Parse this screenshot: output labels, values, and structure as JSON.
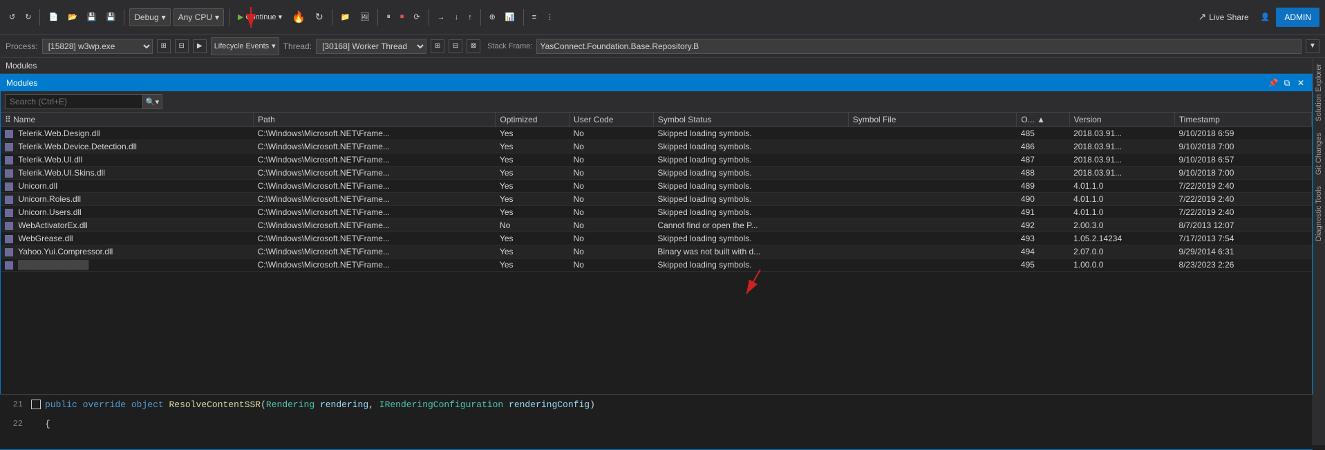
{
  "toolbar": {
    "debug_label": "Debug",
    "any_cpu_label": "Any CPU",
    "continue_label": "Continue",
    "live_share_label": "Live Share",
    "admin_label": "ADMIN"
  },
  "debug_bar": {
    "process_label": "Process:",
    "process_value": "[15828] w3wp.exe",
    "lifecycle_label": "Lifecycle Events",
    "thread_label": "Thread:",
    "thread_value": "[30168] Worker Thread",
    "stack_frame_value": "YasConnect.Foundation.Base.Repository.B"
  },
  "modules_panel": {
    "header": "Modules",
    "window_title": "Modules",
    "search_placeholder": "Search (Ctrl+E)"
  },
  "table": {
    "columns": [
      "Name",
      "Path",
      "Optimized",
      "User Code",
      "Symbol Status",
      "Symbol File",
      "O...",
      "Version",
      "Timestamp"
    ],
    "rows": [
      {
        "name": "Telerik.Web.Design.dll",
        "path": "C:\\Windows\\Microsoft.NET\\Frame...",
        "optimized": "Yes",
        "user_code": "No",
        "symbol_status": "Skipped loading symbols.",
        "symbol_file": "",
        "o": "485",
        "version": "2018.03.91...",
        "timestamp": "9/10/2018 6:59"
      },
      {
        "name": "Telerik.Web.Device.Detection.dll",
        "path": "C:\\Windows\\Microsoft.NET\\Frame...",
        "optimized": "Yes",
        "user_code": "No",
        "symbol_status": "Skipped loading symbols.",
        "symbol_file": "",
        "o": "486",
        "version": "2018.03.91...",
        "timestamp": "9/10/2018 7:00"
      },
      {
        "name": "Telerik.Web.UI.dll",
        "path": "C:\\Windows\\Microsoft.NET\\Frame...",
        "optimized": "Yes",
        "user_code": "No",
        "symbol_status": "Skipped loading symbols.",
        "symbol_file": "",
        "o": "487",
        "version": "2018.03.91...",
        "timestamp": "9/10/2018 6:57"
      },
      {
        "name": "Telerik.Web.UI.Skins.dll",
        "path": "C:\\Windows\\Microsoft.NET\\Frame...",
        "optimized": "Yes",
        "user_code": "No",
        "symbol_status": "Skipped loading symbols.",
        "symbol_file": "",
        "o": "488",
        "version": "2018.03.91...",
        "timestamp": "9/10/2018 7:00"
      },
      {
        "name": "Unicorn.dll",
        "path": "C:\\Windows\\Microsoft.NET\\Frame...",
        "optimized": "Yes",
        "user_code": "No",
        "symbol_status": "Skipped loading symbols.",
        "symbol_file": "",
        "o": "489",
        "version": "4.01.1.0",
        "timestamp": "7/22/2019 2:40"
      },
      {
        "name": "Unicorn.Roles.dll",
        "path": "C:\\Windows\\Microsoft.NET\\Frame...",
        "optimized": "Yes",
        "user_code": "No",
        "symbol_status": "Skipped loading symbols.",
        "symbol_file": "",
        "o": "490",
        "version": "4.01.1.0",
        "timestamp": "7/22/2019 2:40"
      },
      {
        "name": "Unicorn.Users.dll",
        "path": "C:\\Windows\\Microsoft.NET\\Frame...",
        "optimized": "Yes",
        "user_code": "No",
        "symbol_status": "Skipped loading symbols.",
        "symbol_file": "",
        "o": "491",
        "version": "4.01.1.0",
        "timestamp": "7/22/2019 2:40"
      },
      {
        "name": "WebActivatorEx.dll",
        "path": "C:\\Windows\\Microsoft.NET\\Frame...",
        "optimized": "No",
        "user_code": "No",
        "symbol_status": "Cannot find or open the P...",
        "symbol_file": "",
        "o": "492",
        "version": "2.00.3.0",
        "timestamp": "8/7/2013 12:07"
      },
      {
        "name": "WebGrease.dll",
        "path": "C:\\Windows\\Microsoft.NET\\Frame...",
        "optimized": "Yes",
        "user_code": "No",
        "symbol_status": "Skipped loading symbols.",
        "symbol_file": "",
        "o": "493",
        "version": "1.05.2.14234",
        "timestamp": "7/17/2013 7:54"
      },
      {
        "name": "Yahoo.Yui.Compressor.dll",
        "path": "C:\\Windows\\Microsoft.NET\\Frame...",
        "optimized": "Yes",
        "user_code": "No",
        "symbol_status": "Binary was not built with d...",
        "symbol_file": "",
        "o": "494",
        "version": "2.07.0.0",
        "timestamp": "9/29/2014 6:31"
      },
      {
        "name": "████████████",
        "path": "C:\\Windows\\Microsoft.NET\\Frame...",
        "optimized": "Yes",
        "user_code": "No",
        "symbol_status": "Skipped loading symbols.",
        "symbol_file": "",
        "o": "495",
        "version": "1.00.0.0",
        "timestamp": "8/23/2023 2:26"
      }
    ]
  },
  "code_panel": {
    "line21": "21",
    "line22": "22",
    "code21": "public override object ResolveContentSSR(Rendering rendering, IRenderingConfiguration renderingConfig)",
    "code22": "{"
  },
  "sidebar_tabs": [
    "Solution Explorer",
    "Git Changes",
    "Diagnostic Tools"
  ]
}
